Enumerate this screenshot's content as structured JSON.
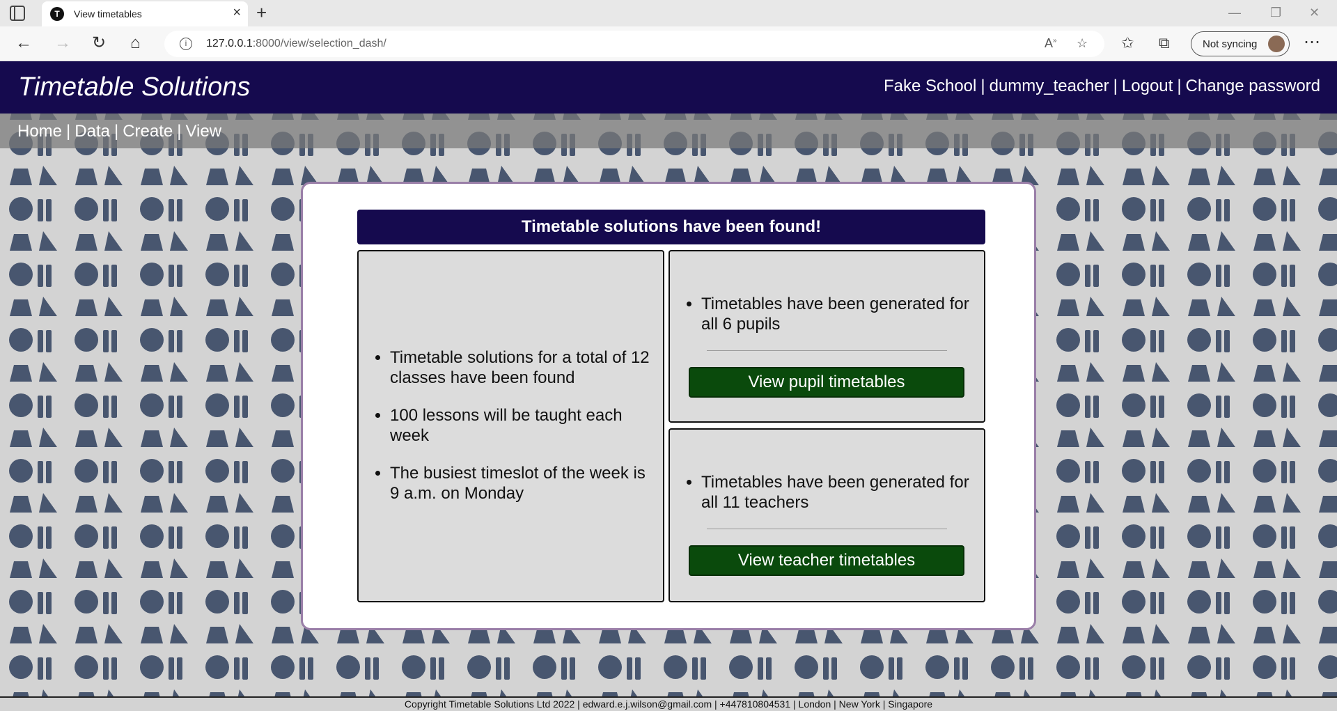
{
  "browser": {
    "tab_title": "View timetables",
    "tab_favicon": "T",
    "url_host": "127.0.0.1",
    "url_rest": ":8000/view/selection_dash/",
    "sync_label": "Not syncing",
    "icons": [
      "sidebar-icon",
      "back-icon",
      "forward-icon",
      "refresh-icon",
      "home-icon",
      "info-icon",
      "read-aloud-icon",
      "add-favorite-icon",
      "favorites-icon",
      "collections-icon",
      "more-icon"
    ]
  },
  "header": {
    "title": "Timetable Solutions",
    "school": "Fake School",
    "user": "dummy_teacher",
    "logout": "Logout",
    "change_password": "Change password",
    "separator": "|"
  },
  "menu": {
    "home": "Home",
    "data": "Data",
    "create": "Create",
    "view": "View",
    "separator": "|"
  },
  "main": {
    "banner": "Timetable solutions have been found!",
    "summary": [
      "Timetable solutions for a total of 12 classes have been found",
      "100 lessons will be taught each week",
      "The busiest timeslot of the week is 9 a.m. on Monday"
    ],
    "pupils": {
      "text": "Timetables have been generated for all 6 pupils",
      "button": "View pupil timetables"
    },
    "teachers": {
      "text": "Timetables have been generated for all 11 teachers",
      "button": "View teacher timetables"
    }
  },
  "footer": {
    "text": "Copyright Timetable Solutions Ltd 2022 | edward.e.j.wilson@gmail.com | +447810804531 | London | New York | Singapore"
  },
  "colors": {
    "header_bg": "#150a4e",
    "button_bg": "#0a4a0c",
    "icon_color": "#48566f",
    "card_border": "#9a7fa8"
  }
}
